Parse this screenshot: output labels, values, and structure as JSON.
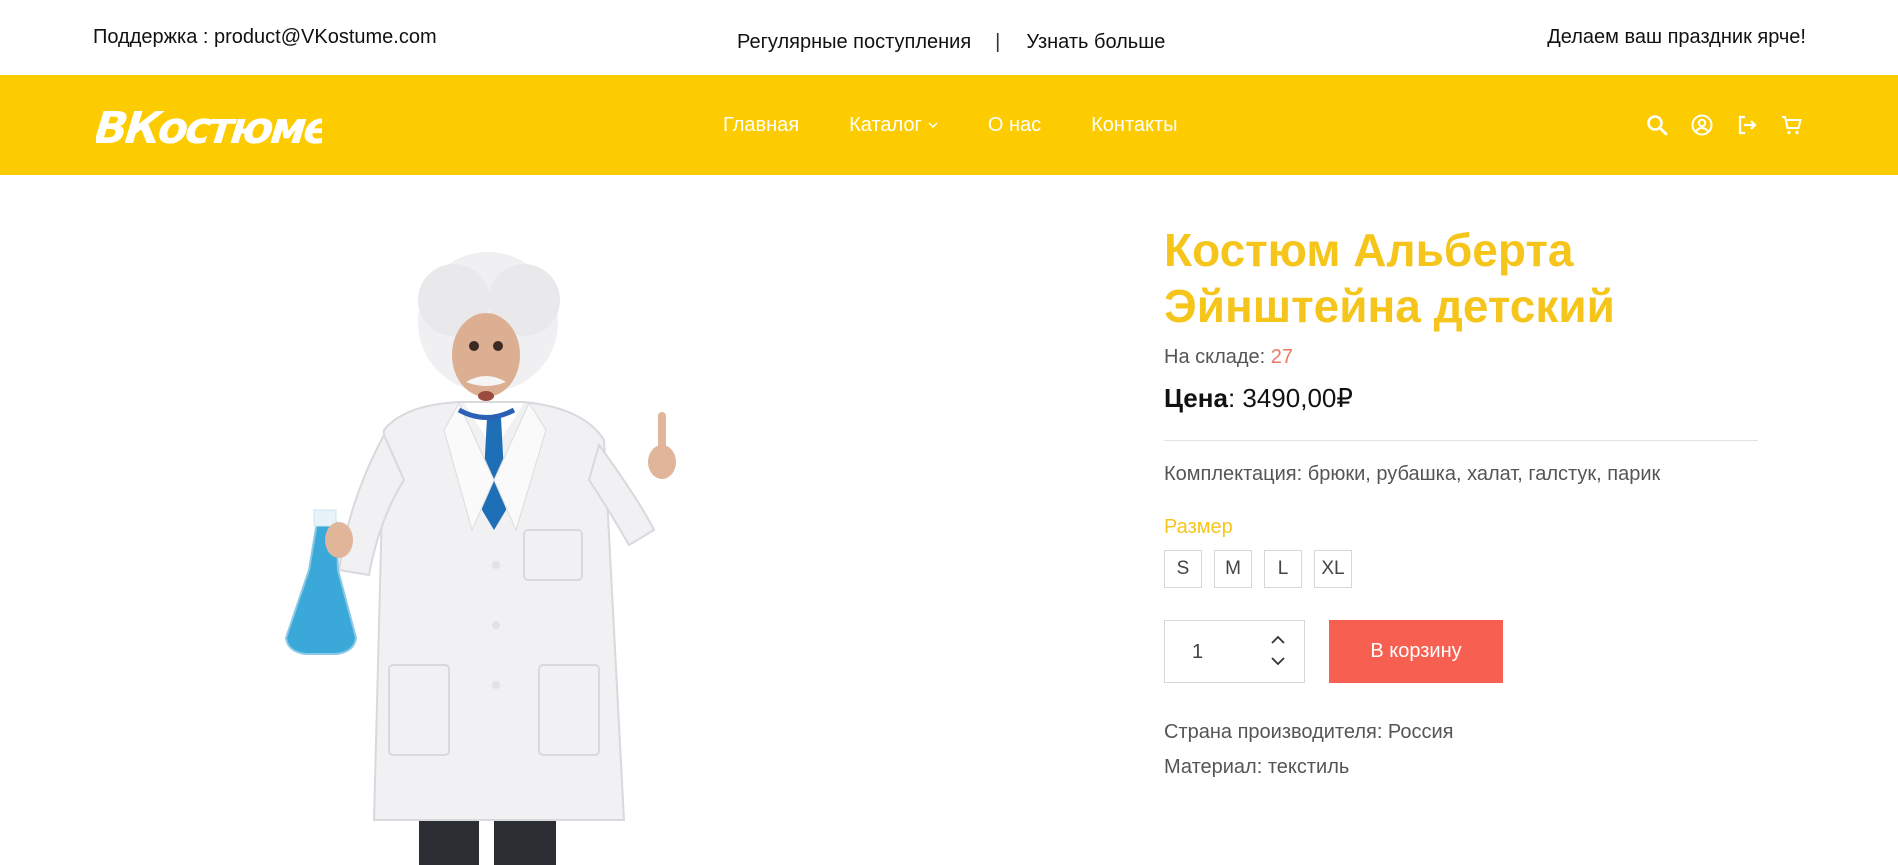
{
  "topbar": {
    "support_text": "Поддержка : product@VKostume.com",
    "arrivals_link": "Регулярные поступления",
    "separator": "|",
    "learn_more_link": "Узнать больше",
    "slogan": "Делаем ваш праздник ярче!"
  },
  "header": {
    "logo_text": "ВКостюме",
    "nav": [
      {
        "label": "Главная"
      },
      {
        "label": "Каталог"
      },
      {
        "label": "О нас"
      },
      {
        "label": "Контакты"
      }
    ],
    "icons": [
      "search-icon",
      "account-icon",
      "logout-icon",
      "cart-icon"
    ]
  },
  "product": {
    "title": "Костюм Альберта Эйнштейна детский",
    "stock_label": "На складе: ",
    "stock_value": "27",
    "price_label": "Цена",
    "price_value": ": 3490,00₽",
    "kit": "Комплектация: брюки, рубашка, халат, галстук, парик",
    "size_label": "Размер",
    "sizes": [
      "S",
      "M",
      "L",
      "XL"
    ],
    "quantity": "1",
    "add_to_cart": "В корзину",
    "country": "Страна производителя: Россия",
    "material": "Материал: текстиль"
  },
  "colors": {
    "brand_yellow": "#fdcc00",
    "title_yellow": "#f6c51c",
    "button_red": "#f76051",
    "stock_accent": "#ea7a63"
  }
}
